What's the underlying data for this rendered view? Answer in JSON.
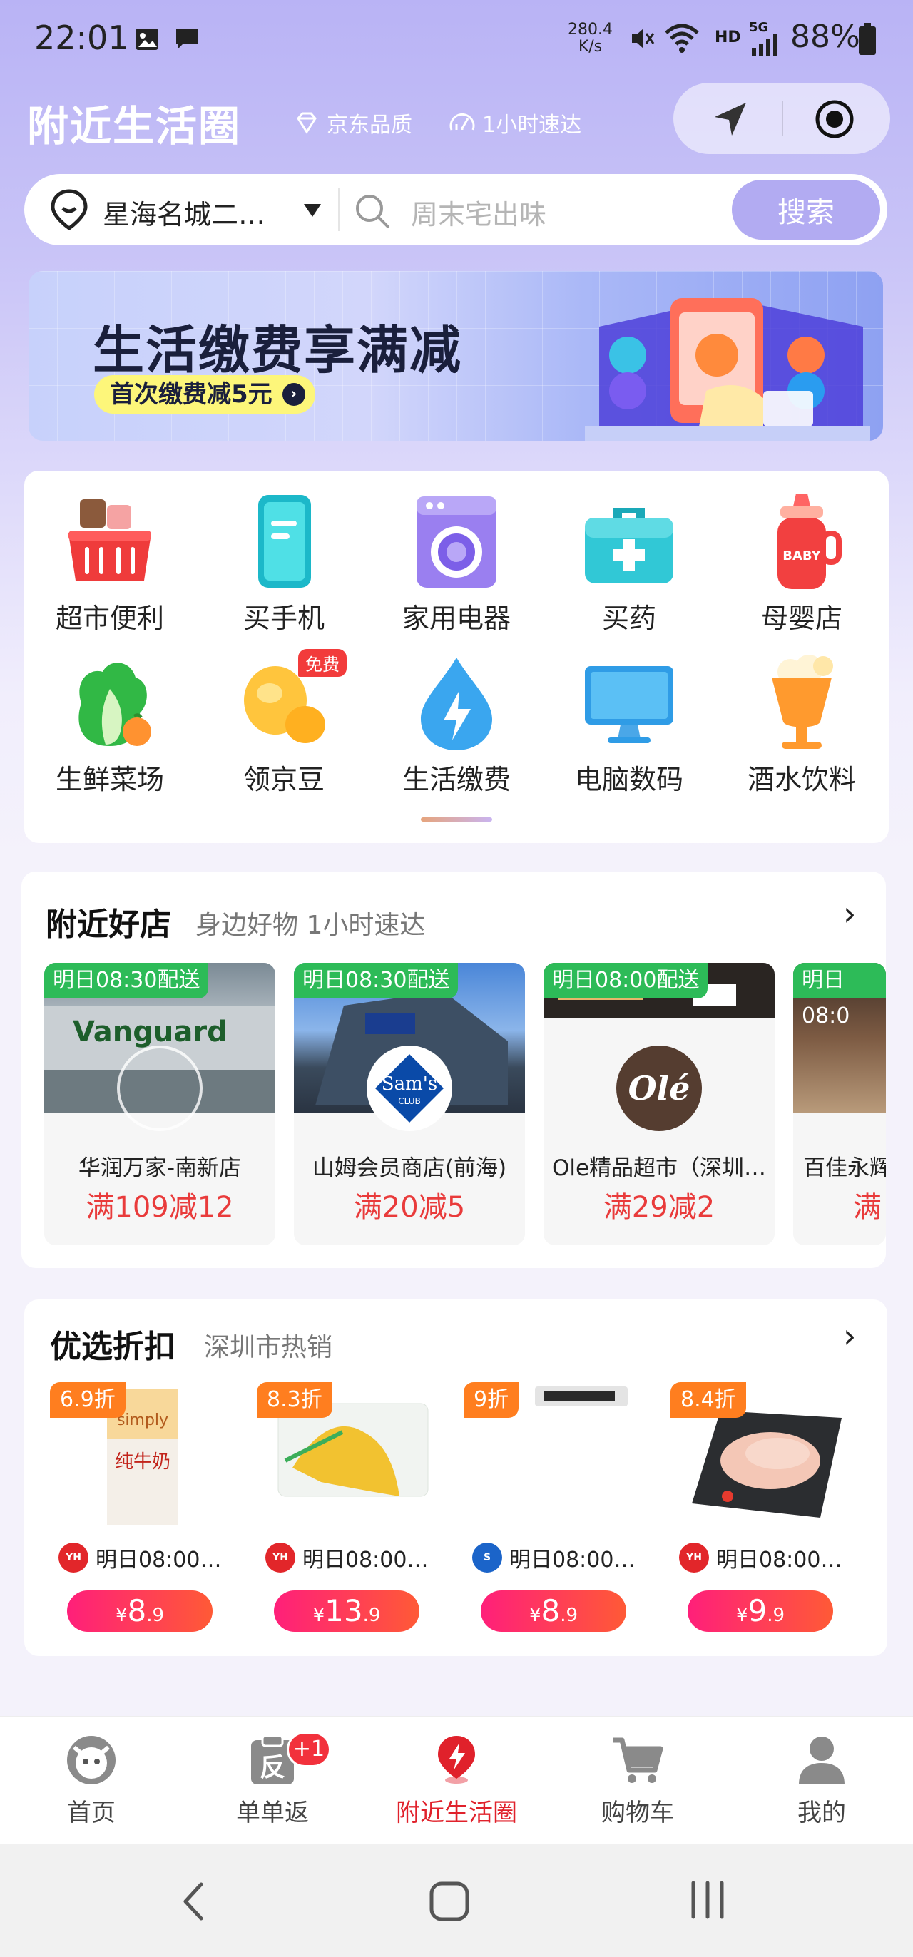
{
  "status_bar": {
    "time": "22:01",
    "net_speed_value": "280.4",
    "net_speed_unit": "K/s",
    "hd": "HD",
    "network": "5G",
    "battery": "88%"
  },
  "header": {
    "title": "附近生活圈",
    "tag_quality": "京东品质",
    "tag_speed": "1小时速达",
    "icons": [
      "navigation-arrow-icon",
      "target-circle-icon"
    ]
  },
  "search": {
    "location": "星海名城二…",
    "placeholder": "周末宅出味",
    "button": "搜索"
  },
  "banner": {
    "title": "生活缴费享满减",
    "subtitle": "首次缴费减5元"
  },
  "categories": [
    {
      "label": "超市便利",
      "icon": "basket-icon"
    },
    {
      "label": "买手机",
      "icon": "phone-icon"
    },
    {
      "label": "家用电器",
      "icon": "washing-machine-icon"
    },
    {
      "label": "买药",
      "icon": "medical-kit-icon"
    },
    {
      "label": "母婴店",
      "icon": "baby-bottle-icon"
    },
    {
      "label": "生鲜菜场",
      "icon": "vegetable-icon"
    },
    {
      "label": "领京豆",
      "icon": "bean-icon",
      "badge": "免费"
    },
    {
      "label": "生活缴费",
      "icon": "water-drop-bolt-icon"
    },
    {
      "label": "电脑数码",
      "icon": "monitor-icon"
    },
    {
      "label": "酒水饮料",
      "icon": "beer-glass-icon"
    }
  ],
  "nearby_stores": {
    "title": "附近好店",
    "subtitle": "身边好物 1小时速达",
    "stores": [
      {
        "badge": "明日08:30配送",
        "name": "华润万家-南新店",
        "deal": "满109减12"
      },
      {
        "badge": "明日08:30配送",
        "name": "山姆会员商店(前海)",
        "deal": "满20减5",
        "logo_text": "Sam's",
        "logo_sub": "CLUB"
      },
      {
        "badge": "明日08:00配送",
        "name": "Ole精品超市（深圳…",
        "deal": "满29减2",
        "logo_text": "Olé"
      },
      {
        "badge": "明日08:0",
        "name": "百佳永辉",
        "deal": "满"
      }
    ]
  },
  "discounts": {
    "title": "优选折扣",
    "subtitle": "深圳市热销",
    "products": [
      {
        "discount": "6.9折",
        "shipping": "明日08:00…",
        "store_logo": "YH",
        "currency": "¥",
        "price_int": "8",
        "price_dec": ".9"
      },
      {
        "discount": "8.3折",
        "shipping": "明日08:00…",
        "store_logo": "YH",
        "currency": "¥",
        "price_int": "13",
        "price_dec": ".9"
      },
      {
        "discount": "9折",
        "shipping": "明日08:00…",
        "store_logo": "S",
        "currency": "¥",
        "price_int": "8",
        "price_dec": ".9"
      },
      {
        "discount": "8.4折",
        "shipping": "明日08:00…",
        "store_logo": "YH",
        "currency": "¥",
        "price_int": "9",
        "price_dec": ".9"
      }
    ]
  },
  "bottom_nav": [
    {
      "label": "首页",
      "icon": "home-mascot-icon"
    },
    {
      "label": "单单返",
      "icon": "rebate-icon",
      "badge": "+1"
    },
    {
      "label": "附近生活圈",
      "icon": "location-bolt-icon",
      "active": true
    },
    {
      "label": "购物车",
      "icon": "cart-icon"
    },
    {
      "label": "我的",
      "icon": "user-icon"
    }
  ],
  "colors": {
    "accent": "#b2abf2",
    "active_red": "#e0212b",
    "deal_red": "#e93b3b",
    "badge_green": "#2dbb58",
    "discount_orange": "#ff7e1f"
  }
}
